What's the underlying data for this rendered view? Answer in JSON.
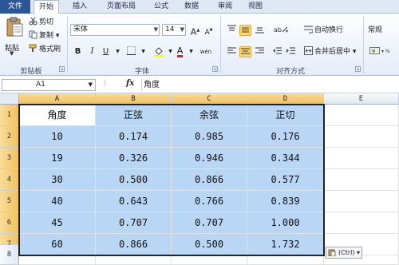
{
  "ribbon_tabs": [
    "文件",
    "开始",
    "插入",
    "页面布局",
    "公式",
    "数据",
    "审阅",
    "视图"
  ],
  "clipboard": {
    "paste_label": "粘贴",
    "cut_label": "剪切",
    "copy_label": "复制 ▾",
    "format_painter_label": "格式刷",
    "group_label": "剪贴板"
  },
  "font": {
    "name": "宋体",
    "size": "14",
    "grow_label": "A",
    "shrink_label": "A",
    "bold": "B",
    "italic": "I",
    "underline": "U",
    "font_color": "A",
    "phonetic_label": "wén",
    "group_label": "字体"
  },
  "alignment": {
    "wrap_label": "自动换行",
    "merge_label": "合并后居中 ▾",
    "group_label": "对齐方式"
  },
  "number": {
    "format": "常规"
  },
  "formula_bar": {
    "name_box": "A1",
    "fx": "fx",
    "content": "角度"
  },
  "columns": [
    "A",
    "B",
    "C",
    "D",
    "E"
  ],
  "rows": [
    "1",
    "2",
    "3",
    "4",
    "5",
    "6",
    "7",
    "8"
  ],
  "table": {
    "headers": [
      "角度",
      "正弦",
      "余弦",
      "正切"
    ],
    "data": [
      [
        "10",
        "0.174",
        "0.985",
        "0.176"
      ],
      [
        "19",
        "0.326",
        "0.946",
        "0.344"
      ],
      [
        "30",
        "0.500",
        "0.866",
        "0.577"
      ],
      [
        "40",
        "0.643",
        "0.766",
        "0.839"
      ],
      [
        "45",
        "0.707",
        "0.707",
        "1.000"
      ],
      [
        "60",
        "0.866",
        "0.500",
        "1.732"
      ]
    ]
  },
  "paste_options": {
    "label": "(Ctrl) ▾"
  },
  "colors": {
    "selection_fill": "#b9d6f5",
    "file_tab": "#2b5797",
    "header_highlight": "#f1c15f"
  }
}
